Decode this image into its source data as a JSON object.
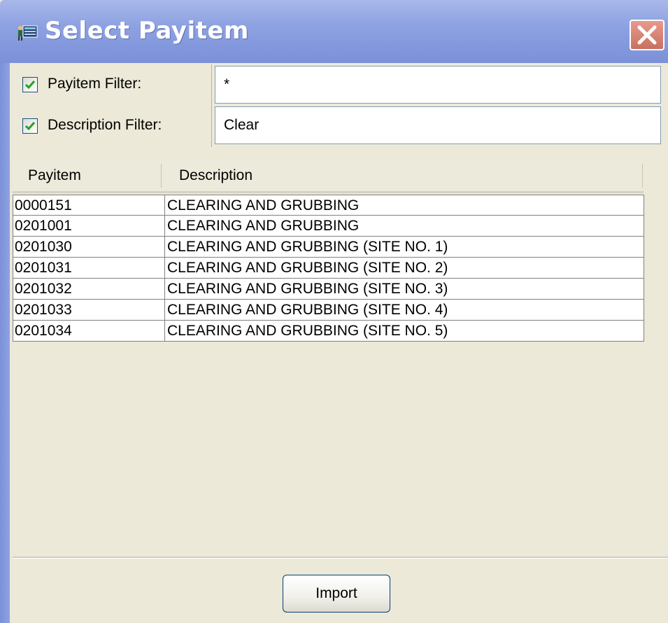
{
  "window": {
    "title": "Select Payitem"
  },
  "filters": {
    "payitem": {
      "label": "Payitem Filter:",
      "checked": true,
      "value": "*"
    },
    "description": {
      "label": "Description Filter:",
      "checked": true,
      "value": "Clear"
    }
  },
  "table": {
    "columns": [
      "Payitem",
      "Description"
    ],
    "rows": [
      {
        "payitem": "0000151",
        "description": "CLEARING AND GRUBBING"
      },
      {
        "payitem": "0201001",
        "description": "CLEARING AND GRUBBING"
      },
      {
        "payitem": "0201030",
        "description": "CLEARING AND GRUBBING (SITE NO. 1)"
      },
      {
        "payitem": "0201031",
        "description": "CLEARING AND GRUBBING (SITE NO. 2)"
      },
      {
        "payitem": "0201032",
        "description": "CLEARING AND GRUBBING (SITE NO. 3)"
      },
      {
        "payitem": "0201033",
        "description": "CLEARING AND GRUBBING (SITE NO. 4)"
      },
      {
        "payitem": "0201034",
        "description": "CLEARING AND GRUBBING (SITE NO. 5)"
      }
    ]
  },
  "buttons": {
    "import_label": "Import"
  },
  "icons": {
    "title_icon": "payitem-app-icon",
    "close": "close-icon",
    "checkbox_check": "checkmark-icon"
  },
  "colors": {
    "titlebar": "#8ea2e2",
    "close_button": "#c9705f",
    "checkmark": "#21a121",
    "window_bg": "#ece9d8"
  }
}
